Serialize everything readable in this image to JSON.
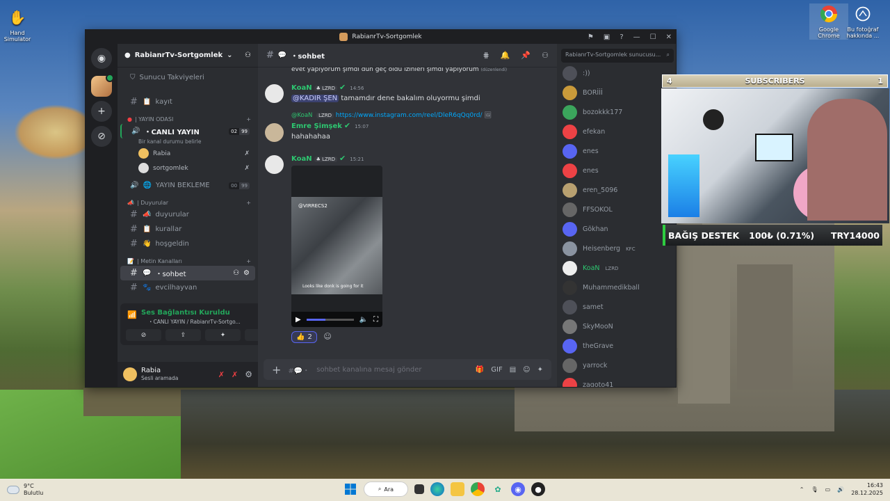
{
  "desktop": {
    "icons": [
      {
        "label": "Hand Simulator",
        "icon": "hand-icon"
      },
      {
        "label": "Google Chrome",
        "icon": "chrome-icon"
      },
      {
        "label": "Bu fotoğraf hakkında ...",
        "icon": "camera-info-icon"
      }
    ]
  },
  "window": {
    "title": "RabianrTv-Sortgomlek"
  },
  "server": {
    "name": "RabianrTv-Sortgomlek",
    "boosts": "Sunucu Takviyeleri"
  },
  "channels": {
    "kayit": "kayıt",
    "cat_yayin": "| YAYIN ODASI",
    "canli_yayin": "・CANLI YAYIN",
    "canli_status": "Bir kanal durumu belirle",
    "canli_count": [
      "02",
      "99"
    ],
    "voice_users": [
      "Rabia",
      "sortgomlek"
    ],
    "yayin_bekleme": "YAYIN BEKLEME",
    "bekleme_count": [
      "00",
      "99"
    ],
    "cat_duyurular": "| Duyurular",
    "duyurular": "duyurular",
    "kurallar": "kurallar",
    "hosgeldin": "hoşgeldin",
    "cat_metin": "| Metin Kanalları",
    "sohbet": "・sohbet",
    "evcilhayvan": "evcilhayvan"
  },
  "voice_panel": {
    "title": "Ses Bağlantısı Kuruldu",
    "sub": "・CANLI YAYIN / RabianrTv-Sortgo..."
  },
  "user_panel": {
    "name": "Rabia",
    "status": "Sesli aramada"
  },
  "chat": {
    "channel": "・sohbet",
    "search_placeholder": "RabianrTv-Sortgomlek sunucusu...",
    "partial_top": "evet yapıyorum şimdi dün geç oldu izinleri şimdi yapıyorum",
    "partial_edited": "(düzenlendi)",
    "messages": [
      {
        "author": "KoaN",
        "tag": "LZRD",
        "time": "14:56",
        "mention": "@KADIR ŞEN",
        "text": "tamamdır dene bakalım oluyormu şimdi"
      },
      {
        "reply_author": "@KoaN",
        "reply_tag": "LZRD",
        "reply_link": "https://www.instagram.com/reel/DleR6qQq0rd/",
        "author": "Emre Şimşek",
        "time": "15:07",
        "text": "hahahahaa"
      },
      {
        "author": "KoaN",
        "tag": "LZRD",
        "time": "15:21",
        "video_handle": "@VIRRECS2",
        "video_caption": "Looks like donk is going for it",
        "reaction_count": "2"
      }
    ],
    "composer_placeholder": "sohbet kanalına mesaj gönder"
  },
  "members": [
    ":))",
    "BORİİİ",
    "bozokkk177",
    "efekan",
    "enes",
    "enes",
    "eren_5096",
    "FFSOKOL",
    "Gökhan",
    "Heisenberg",
    "KoaN",
    "Muhammedikball",
    "samet",
    "SkyMooN",
    "theGrave",
    "yarrock",
    "zagoto41"
  ],
  "member_tags": {
    "Heisenberg": "KFC",
    "KoaN": "LZRD"
  },
  "overlay": {
    "sub_left": "4",
    "sub_title": "SUBSCRIBERS",
    "sub_right": "1",
    "donate_label": "BAĞIŞ DESTEK",
    "donate_amount": "100₺ (0.71%)",
    "donate_goal": "TRY14000"
  },
  "taskbar": {
    "temp": "9°C",
    "weather": "Bulutlu",
    "search": "Ara",
    "time": "16:43",
    "date": "28.12.2025"
  },
  "colors": {
    "discord_green": "#23a55a",
    "blurple": "#5865f2",
    "donate_green": "#2ecc40"
  }
}
